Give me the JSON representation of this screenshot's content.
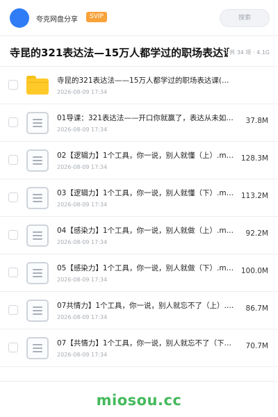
{
  "header": {
    "username": "夸克网盘分享",
    "badge": "SVIP",
    "search_placeholder": "搜索"
  },
  "share": {
    "title": "寺昆的321表达法—15万人都学过的职场表达课",
    "meta": "共 34 项 · 4.1G"
  },
  "files": [
    {
      "type": "folder",
      "icon": "folder-icon",
      "name": "寺昆的321表达法——15万人都学过的职场表达课(…",
      "date": "2026-08-09 17:34",
      "size": ""
    },
    {
      "type": "file",
      "icon": "document-icon",
      "name": "01导课：321表达法——开口你就赢了，表达从未如…",
      "date": "2026-08-09 17:34",
      "size": "37.8M"
    },
    {
      "type": "file",
      "icon": "document-icon",
      "name": "02【逻辑力】1个工具，你一说，别人就懂（上）.m…",
      "date": "2026-08-09 17:34",
      "size": "128.3M"
    },
    {
      "type": "file",
      "icon": "document-icon",
      "name": "03【逻辑力】1个工具，你一说，别人就懂（下）.m…",
      "date": "2026-08-09 17:34",
      "size": "113.2M"
    },
    {
      "type": "file",
      "icon": "document-icon",
      "name": "04【感染力】1个工具，你一说，别人就做（上）.m…",
      "date": "2026-08-09 17:34",
      "size": "92.2M"
    },
    {
      "type": "file",
      "icon": "document-icon",
      "name": "05【感染力】1个工具，你一说，别人就做（下）.m…",
      "date": "2026-08-09 17:34",
      "size": "100.0M"
    },
    {
      "type": "file",
      "icon": "document-icon",
      "name": "07共情力】1个工具，你一说，别人就忘不了（上）.…",
      "date": "2026-08-09 17:34",
      "size": "86.7M"
    },
    {
      "type": "file",
      "icon": "document-icon",
      "name": "07【共情力】1个工具，你一说，别人就忘不了（下）…",
      "date": "2026-08-09 17:34",
      "size": "70.7M"
    }
  ],
  "footer": {
    "watermark": "miosou.cc"
  },
  "colors": {
    "avatar": "#2f7cf6",
    "badge": "#f8a23a",
    "folder": "#ffc928",
    "watermark": "#44b95b"
  }
}
